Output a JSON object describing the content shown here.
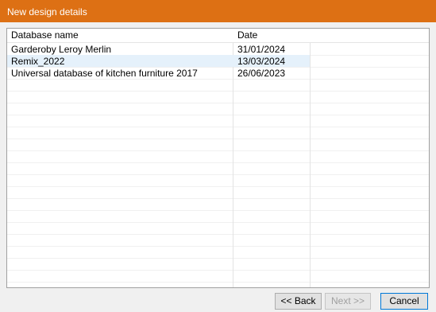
{
  "window": {
    "title": "New design details"
  },
  "table": {
    "columns": [
      "Database name",
      "Date"
    ],
    "rows": [
      {
        "name": "Garderoby Leroy Merlin",
        "date": "31/01/2024",
        "selected": false
      },
      {
        "name": "Remix_2022",
        "date": "13/03/2024",
        "selected": true
      },
      {
        "name": "Universal database of kitchen furniture 2017",
        "date": "26/06/2023",
        "selected": false
      }
    ]
  },
  "buttons": {
    "back_label": "<< Back",
    "next_label": "Next >>",
    "cancel_label": "Cancel"
  },
  "colors": {
    "titlebar": "#dd7014",
    "selection": "#e5f1fb"
  }
}
